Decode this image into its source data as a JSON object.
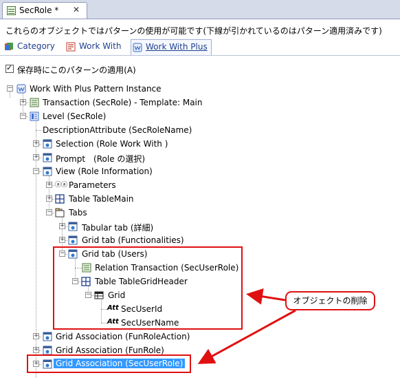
{
  "window": {
    "tab_title": "SecRole *",
    "close_glyph": "✕"
  },
  "description": "これらのオブジェクトではパターンの使用が可能です(下線が引かれているのはパターン適用済みです)",
  "pattern_tabs": [
    {
      "label": "Category",
      "icon": "category-icon"
    },
    {
      "label": "Work With",
      "icon": "work-with-icon"
    },
    {
      "label": "Work With Plus",
      "icon": "work-with-plus-icon",
      "active": true
    }
  ],
  "apply_on_save": {
    "label": "保存時にこのパターンの適用(A)",
    "checked": true
  },
  "tree": {
    "root": "Work With Plus Pattern Instance",
    "transaction": "Transaction (SecRole) - Template: Main",
    "level": "Level (SecRole)",
    "description_attribute": "DescriptionAttribute (SecRoleName)",
    "selection": "Selection (Role Work With )",
    "prompt": "Prompt　(Role の選択)",
    "view": "View (Role Information)",
    "parameters": "Parameters",
    "table_main": "Table TableMain",
    "tabs": "Tabs",
    "tabular_tab": "Tabular tab (詳細)",
    "grid_tab_functionalities": "Grid tab (Functionalities)",
    "grid_tab_users": "Grid tab (Users)",
    "relation_transaction": "Relation Transaction (SecUserRole)",
    "table_grid_header": "Table TableGridHeader",
    "grid": "Grid",
    "sec_user_id": "SecUserId",
    "sec_user_name": "SecUserName",
    "grid_assoc_funroleaction": "Grid Association (FunRoleAction)",
    "grid_assoc_funrole": "Grid Association (FunRole)",
    "grid_assoc_secuserrole": "Grid Association (SecUserRole)"
  },
  "expander": {
    "plus": "+",
    "minus": "−"
  },
  "attr_glyph": "Att",
  "params_glyph": "ⓐⓐ",
  "annotation": {
    "label": "オブジェクトの削除"
  },
  "colors": {
    "highlight_red": "#e01010",
    "selection_blue": "#3399ff"
  }
}
